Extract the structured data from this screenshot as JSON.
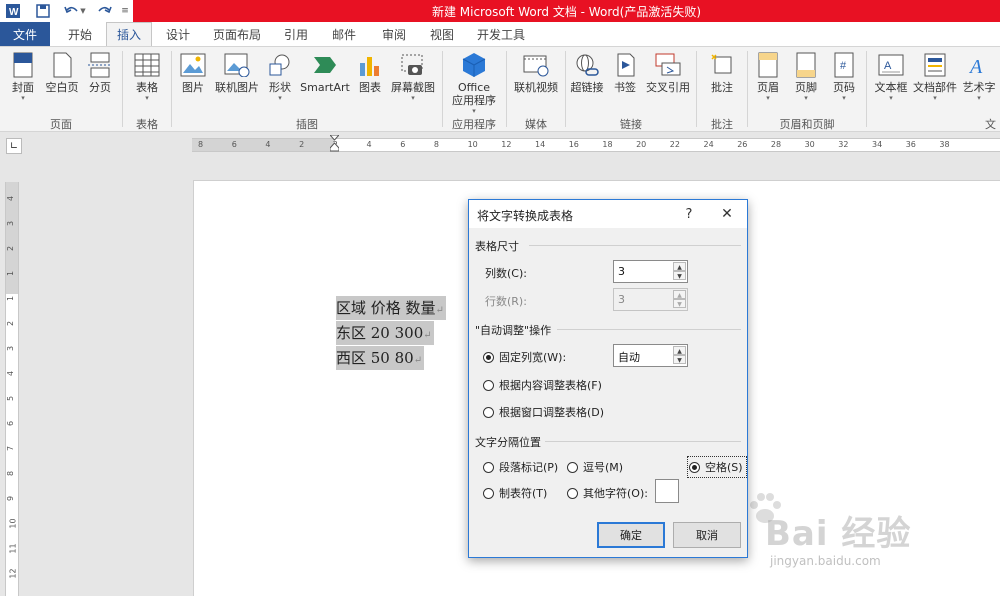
{
  "window": {
    "title": "新建 Microsoft Word 文档 - Word(产品激活失败)"
  },
  "quick_access": [
    "word-logo-icon",
    "save-icon",
    "undo-icon",
    "redo-icon",
    "customize-icon"
  ],
  "tabs": {
    "file": "文件",
    "items": [
      "开始",
      "插入",
      "设计",
      "页面布局",
      "引用",
      "邮件",
      "审阅",
      "视图",
      "开发工具"
    ],
    "active": "插入"
  },
  "ribbon": {
    "buttons": {
      "cover": "封面",
      "blank_page": "空白页",
      "page_break": "分页",
      "table": "表格",
      "picture": "图片",
      "online_picture": "联机图片",
      "shapes": "形状",
      "smartart": "SmartArt",
      "chart": "图表",
      "screenshot": "屏幕截图",
      "office_line1": "Office",
      "office_line2": "应用程序",
      "online_video": "联机视频",
      "hyperlink": "超链接",
      "bookmark": "书签",
      "cross_ref": "交叉引用",
      "comment": "批注",
      "header": "页眉",
      "footer": "页脚",
      "page_number": "页码",
      "textbox": "文本框",
      "doc_parts": "文档部件",
      "wordart": "艺术字"
    },
    "groups": {
      "pages": "页面",
      "tables": "表格",
      "illustrations": "插图",
      "apps": "应用程序",
      "media": "媒体",
      "links": "链接",
      "comments": "批注",
      "header_footer": "页眉和页脚",
      "text": "文"
    }
  },
  "ruler": {
    "h_ticks": [
      "8",
      "6",
      "4",
      "2",
      "2",
      "4",
      "6",
      "8",
      "10",
      "12",
      "14",
      "16",
      "18",
      "20",
      "22",
      "24",
      "26",
      "28",
      "30",
      "32",
      "34",
      "36",
      "38"
    ],
    "v_ticks": [
      "4",
      "3",
      "2",
      "1",
      "1",
      "2",
      "3",
      "4",
      "5",
      "6",
      "7",
      "8",
      "9",
      "10",
      "11",
      "12"
    ]
  },
  "document": {
    "lines": [
      "区域  价格  数量",
      "东区  20 300",
      "西区  50 80"
    ]
  },
  "dialog": {
    "title": "将文字转换成表格",
    "help": "?",
    "close": "✕",
    "size_section": "表格尺寸",
    "cols_label": "列数(C):",
    "cols_value": "3",
    "rows_label": "行数(R):",
    "rows_value": "3",
    "autofit_section": "\"自动调整\"操作",
    "fixed_width_label": "固定列宽(W):",
    "fixed_width_value": "自动",
    "fit_content": "根据内容调整表格(F)",
    "fit_window": "根据窗口调整表格(D)",
    "separator_section": "文字分隔位置",
    "sep_paragraph": "段落标记(P)",
    "sep_comma": "逗号(M)",
    "sep_space": "空格(S)",
    "sep_tab": "制表符(T)",
    "sep_other": "其他字符(O):",
    "selected_separator": "空格(S)",
    "selected_autofit": "固定列宽(W):",
    "ok": "确定",
    "cancel": "取消"
  },
  "watermark": {
    "brand": "Bai 经验",
    "url": "jingyan.baidu.com"
  },
  "colors": {
    "title_bar": "#e81123",
    "file_tab": "#2b579a",
    "dialog_border": "#2b79d6"
  }
}
